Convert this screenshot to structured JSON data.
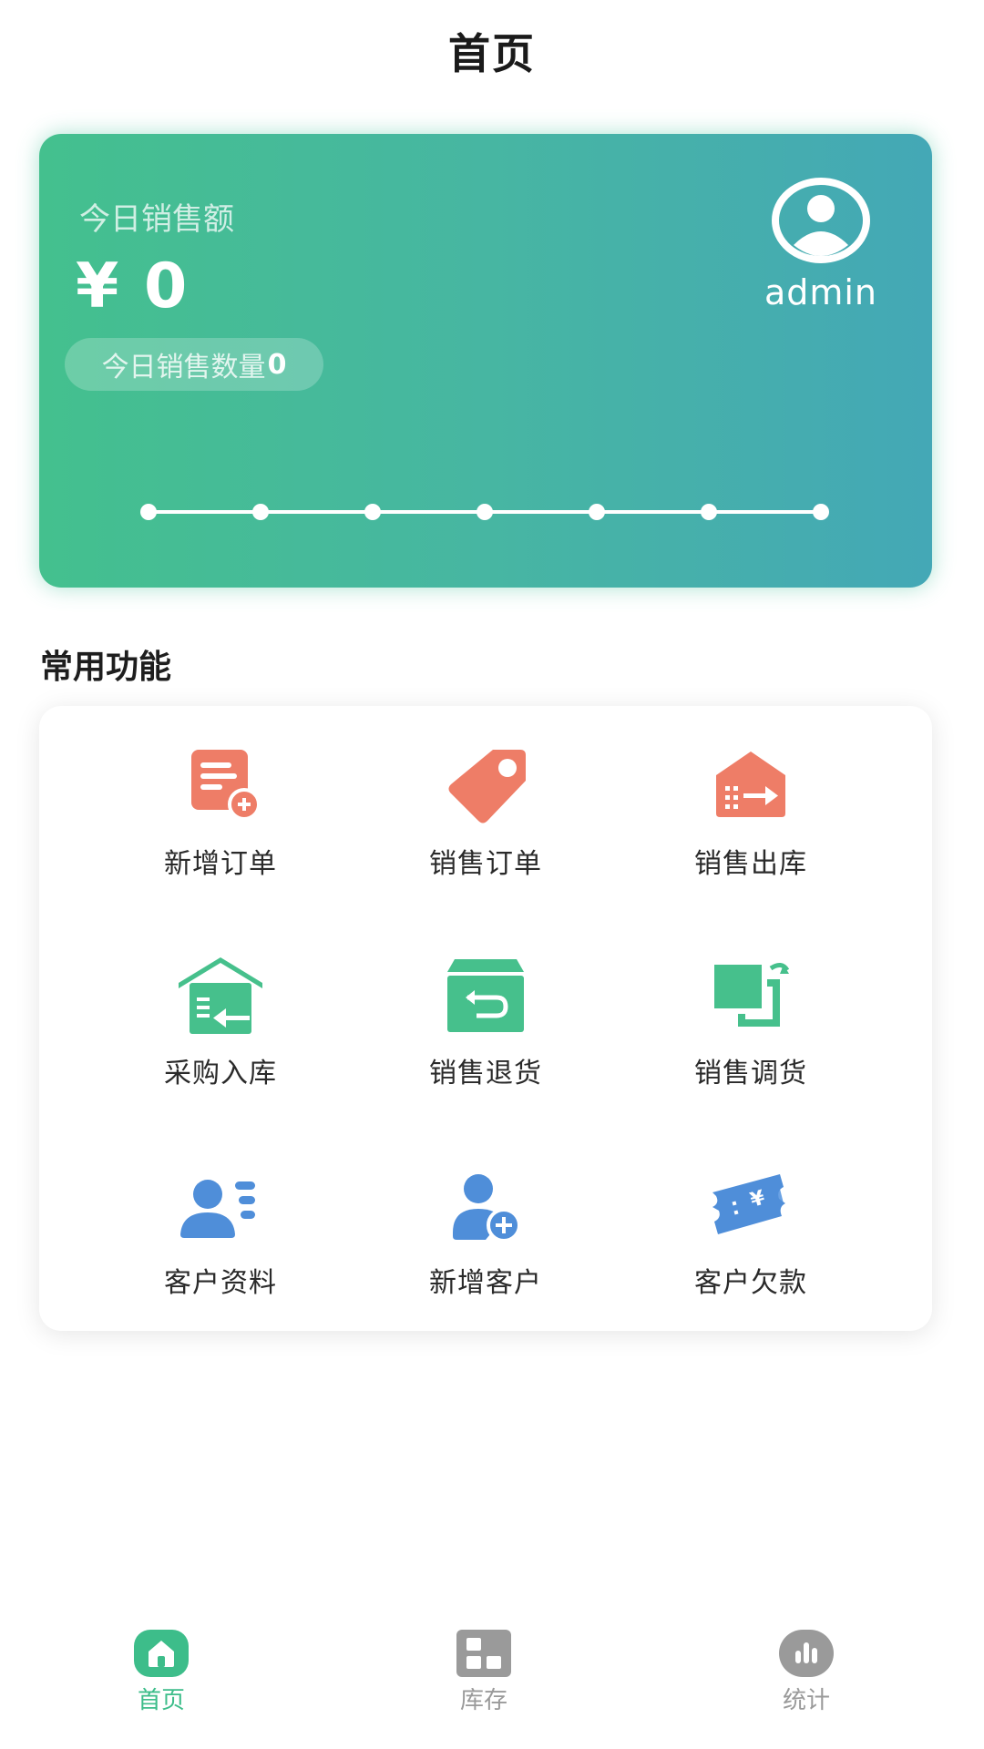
{
  "header": {
    "title": "首页"
  },
  "sales_card": {
    "label": "今日销售额",
    "amount": "¥ 0",
    "qty_label": "今日销售数量",
    "qty_value": "0",
    "username": "admin",
    "trend_points": 7,
    "colors": {
      "gradient_start": "#44c08e",
      "gradient_end": "#44a8b6"
    }
  },
  "section": {
    "title": "常用功能"
  },
  "functions": [
    {
      "label": "新增订单",
      "icon": "add-order-icon",
      "color": "#ee7d67"
    },
    {
      "label": "销售订单",
      "icon": "price-tag-icon",
      "color": "#ee7d67"
    },
    {
      "label": "销售出库",
      "icon": "outbound-warehouse-icon",
      "color": "#ee7d67"
    },
    {
      "label": "采购入库",
      "icon": "inbound-warehouse-icon",
      "color": "#46c08c"
    },
    {
      "label": "销售退货",
      "icon": "return-box-icon",
      "color": "#46c08c"
    },
    {
      "label": "销售调货",
      "icon": "transfer-goods-icon",
      "color": "#46c08c"
    },
    {
      "label": "客户资料",
      "icon": "customer-list-icon",
      "color": "#4f8ed9"
    },
    {
      "label": "新增客户",
      "icon": "add-customer-icon",
      "color": "#4f8ed9"
    },
    {
      "label": "客户欠款",
      "icon": "debt-ticket-icon",
      "color": "#4f8ed9"
    }
  ],
  "tabs": [
    {
      "label": "首页",
      "icon": "home-icon",
      "active": true
    },
    {
      "label": "库存",
      "icon": "inventory-grid-icon",
      "active": false
    },
    {
      "label": "统计",
      "icon": "statistics-icon",
      "active": false
    }
  ],
  "colors": {
    "accent": "#3dbd8a",
    "inactive": "#9a9a9a"
  }
}
